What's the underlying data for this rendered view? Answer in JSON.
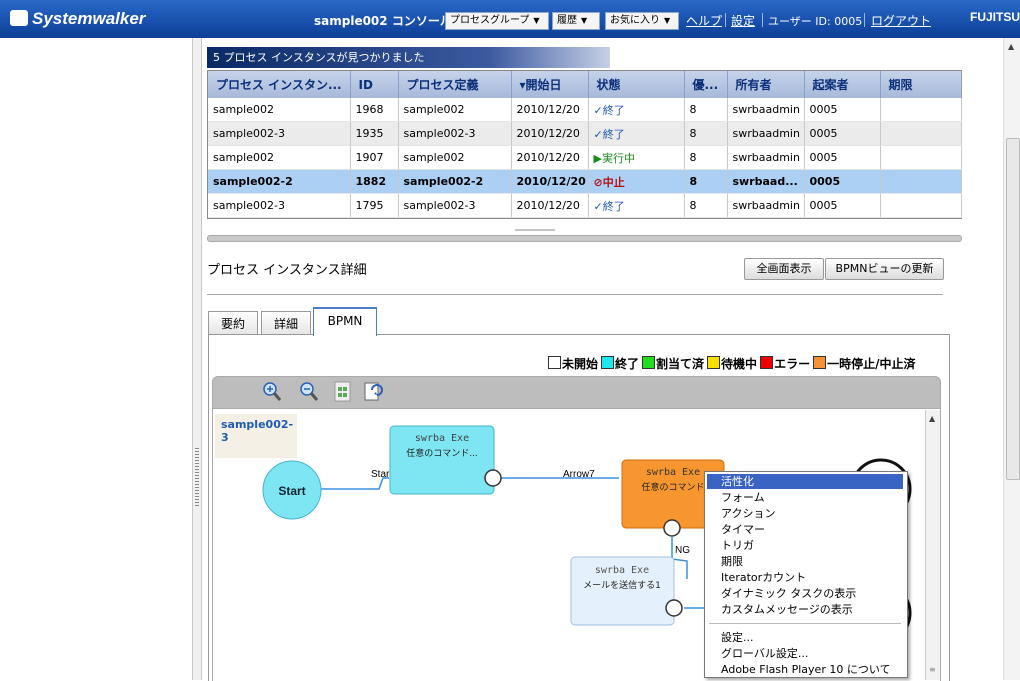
{
  "header": {
    "logo": "Systemwalker",
    "console_title": "sample002 コンソール",
    "menus": [
      {
        "label": "プロセスグループ"
      },
      {
        "label": "履歴"
      },
      {
        "label": "お気に入り"
      }
    ],
    "help": "ヘルプ",
    "settings": "設定",
    "user_label": "ユーザー ID: 0005",
    "logout": "ログアウト",
    "brand": "FUJITSU"
  },
  "results": {
    "banner": "5 プロセス インスタンスが見つかりました",
    "columns": [
      "プロセス インスタン...",
      "ID",
      "プロセス定義",
      "▾開始日",
      "状態",
      "優...",
      "所有者",
      "起案者",
      "期限"
    ],
    "rows": [
      {
        "name": "sample002",
        "id": "1968",
        "def": "sample002",
        "date": "2010/12/20",
        "status_icon": "✓",
        "status": "終了",
        "pri": "8",
        "owner": "swrbaadmin",
        "initiator": "0005",
        "due": ""
      },
      {
        "name": "sample002-3",
        "id": "1935",
        "def": "sample002-3",
        "date": "2010/12/20",
        "status_icon": "✓",
        "status": "終了",
        "pri": "8",
        "owner": "swrbaadmin",
        "initiator": "0005",
        "due": ""
      },
      {
        "name": "sample002",
        "id": "1907",
        "def": "sample002",
        "date": "2010/12/20",
        "status_icon": "▶",
        "status": "実行中",
        "pri": "8",
        "owner": "swrbaadmin",
        "initiator": "0005",
        "due": ""
      },
      {
        "name": "sample002-2",
        "id": "1882",
        "def": "sample002-2",
        "date": "2010/12/20",
        "status_icon": "⊘",
        "status": "中止",
        "pri": "8",
        "owner": "swrbaad...",
        "initiator": "0005",
        "due": ""
      },
      {
        "name": "sample002-3",
        "id": "1795",
        "def": "sample002-3",
        "date": "2010/12/20",
        "status_icon": "✓",
        "status": "終了",
        "pri": "8",
        "owner": "swrbaadmin",
        "initiator": "0005",
        "due": ""
      }
    ]
  },
  "detail": {
    "title": "プロセス インスタンス詳細",
    "fullscreen_btn": "全画面表示",
    "refresh_btn": "BPMNビューの更新",
    "tabs": [
      "要約",
      "詳細",
      "BPMN"
    ]
  },
  "legend": [
    {
      "label": "未開始",
      "color": "#ffffff"
    },
    {
      "label": "終了",
      "color": "#22e6ee"
    },
    {
      "label": "割当て済",
      "color": "#22dd22"
    },
    {
      "label": "待機中",
      "color": "#f6e000"
    },
    {
      "label": "エラー",
      "color": "#ee0000"
    },
    {
      "label": "一時停止/中止済",
      "color": "#f7923a"
    }
  ],
  "bpmn": {
    "process_name": "sample002-3",
    "start_label": "Start",
    "edge_start": "Start",
    "edge_arrow7": "Arrow7",
    "edge_ng": "NG",
    "node1": {
      "title": "swrba Exe",
      "sub": "任意のコマンド..."
    },
    "node2": {
      "title": "swrba Exe",
      "sub": "任意のコマンド"
    },
    "node3": {
      "title": "swrba Exe",
      "sub": "メールを送信する1"
    },
    "colors": {
      "done": "#7ee6f2",
      "stopped": "#f7962f",
      "notstarted": "#e4f0fb"
    }
  },
  "context_menu": {
    "items": [
      "活性化",
      "フォーム",
      "アクション",
      "タイマー",
      "トリガ",
      "期限",
      "Iteratorカウント",
      "ダイナミック タスクの表示",
      "カスタムメッセージの表示"
    ],
    "items2": [
      "設定...",
      "グローバル設定...",
      "Adobe Flash Player 10 について"
    ]
  }
}
